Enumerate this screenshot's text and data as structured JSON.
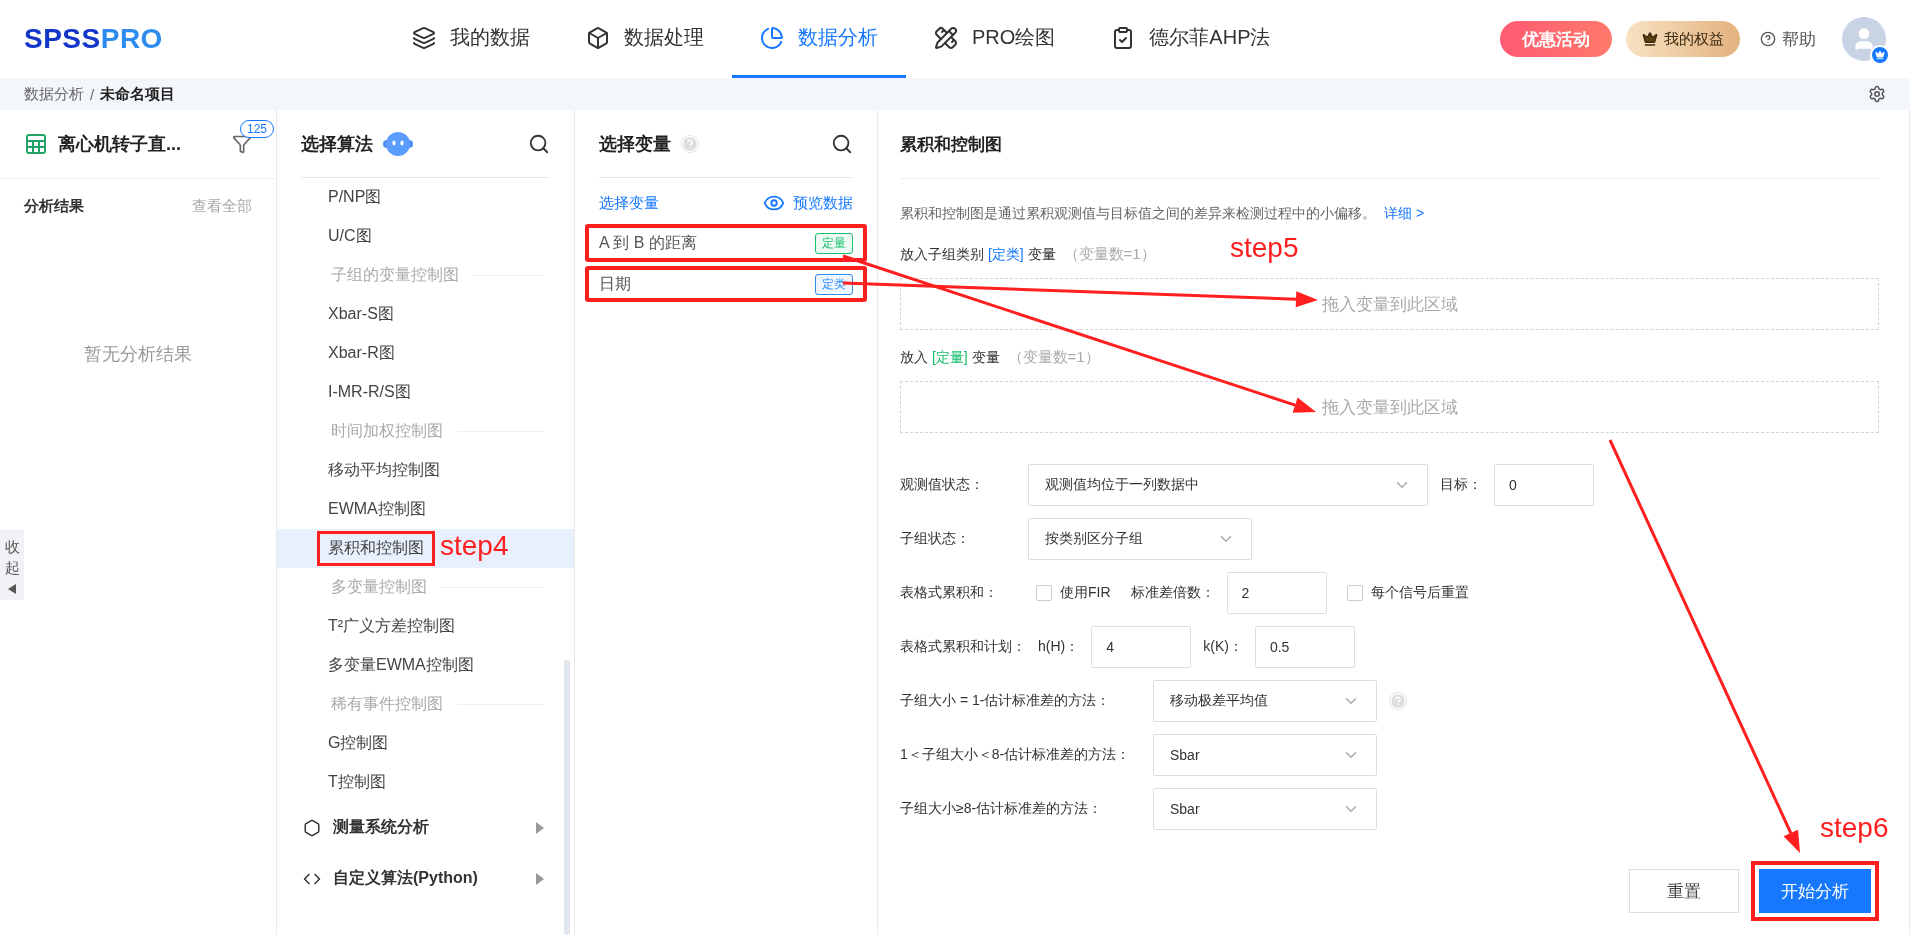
{
  "header": {
    "logo": {
      "dark": "SPSS",
      "light": "PRO"
    },
    "nav": [
      {
        "label": "我的数据",
        "selected": false
      },
      {
        "label": "数据处理",
        "selected": false
      },
      {
        "label": "数据分析",
        "selected": true
      },
      {
        "label": "PRO绘图",
        "selected": false
      },
      {
        "label": "德尔菲AHP法",
        "selected": false
      }
    ],
    "promo": "优惠活动",
    "benefits": "我的权益",
    "help": "帮助"
  },
  "breadcrumb": {
    "parent": "数据分析",
    "separator": "/",
    "current": "未命名项目"
  },
  "project": {
    "name": "离心机转子直...",
    "filter_count": "125"
  },
  "results": {
    "title": "分析结果",
    "view_all": "查看全部",
    "empty": "暂无分析结果"
  },
  "collapse": {
    "label": "收起"
  },
  "algorithms": {
    "title": "选择算法",
    "items": [
      {
        "kind": "item",
        "label": "P/NP图",
        "selected": false,
        "highlighted": false
      },
      {
        "kind": "item",
        "label": "U/C图",
        "selected": false,
        "highlighted": false
      },
      {
        "kind": "group",
        "label": "子组的变量控制图"
      },
      {
        "kind": "item",
        "label": "Xbar-S图",
        "selected": false,
        "highlighted": false
      },
      {
        "kind": "item",
        "label": "Xbar-R图",
        "selected": false,
        "highlighted": false
      },
      {
        "kind": "item",
        "label": "I-MR-R/S图",
        "selected": false,
        "highlighted": false
      },
      {
        "kind": "group",
        "label": "时间加权控制图"
      },
      {
        "kind": "item",
        "label": "移动平均控制图",
        "selected": false,
        "highlighted": false
      },
      {
        "kind": "item",
        "label": "EWMA控制图",
        "selected": false,
        "highlighted": false
      },
      {
        "kind": "item",
        "label": "累积和控制图",
        "selected": true,
        "highlighted": true
      },
      {
        "kind": "group",
        "label": "多变量控制图"
      },
      {
        "kind": "item",
        "label": "T²广义方差控制图",
        "selected": false,
        "highlighted": false
      },
      {
        "kind": "item",
        "label": "多变量EWMA控制图",
        "selected": false,
        "highlighted": false
      },
      {
        "kind": "group",
        "label": "稀有事件控制图"
      },
      {
        "kind": "item",
        "label": "G控制图",
        "selected": false,
        "highlighted": false
      },
      {
        "kind": "item",
        "label": "T控制图",
        "selected": false,
        "highlighted": false
      }
    ],
    "categories": [
      {
        "label": "测量系统分析"
      },
      {
        "label": "自定义算法(Python)"
      }
    ]
  },
  "variables": {
    "title": "选择变量",
    "subtitle": "选择变量",
    "preview": "预览数据",
    "items": [
      {
        "name": "A 到 B 的距离",
        "tag": "定量",
        "color": "#19be6b",
        "highlighted": true
      },
      {
        "name": "日期",
        "tag": "定类",
        "color": "#2d8cf0",
        "highlighted": true
      }
    ]
  },
  "analysis": {
    "title": "累积和控制图",
    "description": "累积和控制图是通过累积观测值与目标值之间的差异来检测过程中的小偏移。",
    "detail_link": "详细 >",
    "slots": [
      {
        "prefix": "放入子组类别",
        "tag": "[定类]",
        "color": "#1677ff",
        "suffix": "变量",
        "count": "（变量数=1）",
        "placeholder": "拖入变量到此区域"
      },
      {
        "prefix": "放入",
        "tag": "[定量]",
        "color": "#19be6b",
        "suffix": "变量",
        "count": "（变量数=1）",
        "placeholder": "拖入变量到此区域"
      }
    ],
    "rows": [
      {
        "label": "观测值状态：",
        "fields": [
          {
            "kind": "long-select",
            "value": "观测值均位于一列数据中"
          },
          {
            "kind": "text",
            "text": "目标："
          },
          {
            "kind": "input",
            "value": "0"
          }
        ]
      },
      {
        "label": "子组状态：",
        "fields": [
          {
            "kind": "select",
            "value": "按类别区分子组"
          }
        ]
      },
      {
        "label": "表格式累积和：",
        "fields": [
          {
            "kind": "checkbox",
            "text": "使用FIR",
            "checked": false
          },
          {
            "kind": "text",
            "text": "标准差倍数："
          },
          {
            "kind": "input",
            "value": "2"
          },
          {
            "kind": "checkbox",
            "text": "每个信号后重置",
            "checked": false
          }
        ]
      },
      {
        "label": "表格式累积和计划：",
        "fields": [
          {
            "kind": "text",
            "text": "h(H)："
          },
          {
            "kind": "input",
            "value": "4"
          },
          {
            "kind": "text",
            "text": "k(K)："
          },
          {
            "kind": "input",
            "value": "0.5"
          }
        ]
      },
      {
        "label": "子组大小 = 1-估计标准差的方法：",
        "fields": [
          {
            "kind": "select",
            "value": "移动极差平均值"
          },
          {
            "kind": "help"
          }
        ]
      },
      {
        "label": "1＜子组大小＜8-估计标准差的方法：",
        "fields": [
          {
            "kind": "select",
            "value": "Sbar"
          }
        ]
      },
      {
        "label": "子组大小≥8-估计标准差的方法：",
        "fields": [
          {
            "kind": "select",
            "value": "Sbar"
          }
        ]
      }
    ],
    "reset": "重置",
    "start": "开始分析",
    "start_highlighted": true
  },
  "annotations": [
    {
      "label": "step4"
    },
    {
      "label": "step5"
    },
    {
      "label": "step6"
    }
  ]
}
